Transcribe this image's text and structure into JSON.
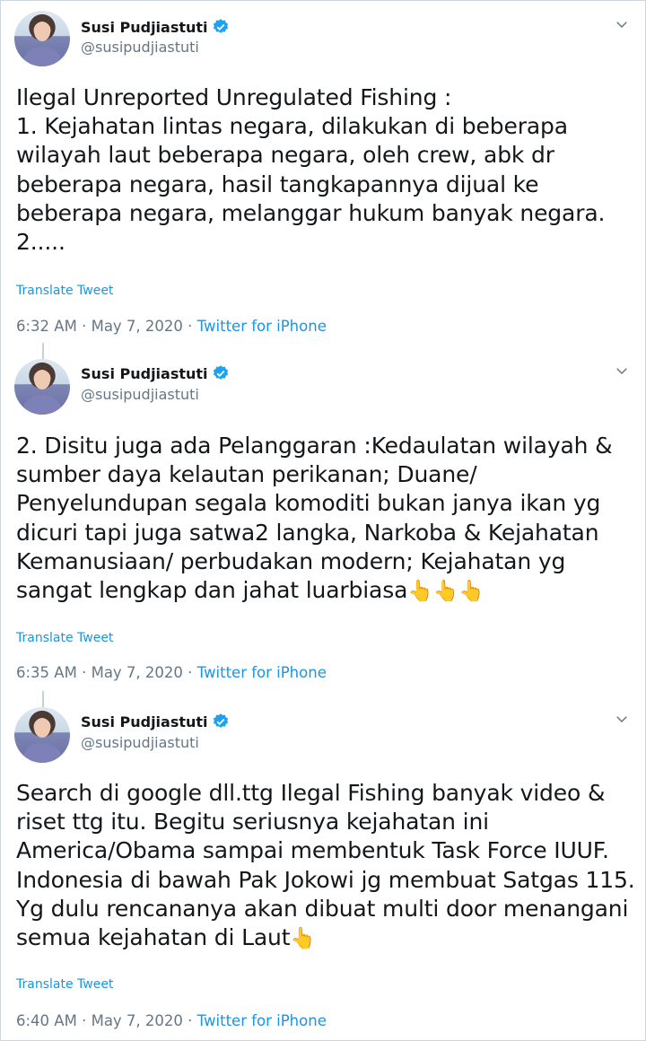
{
  "tweets": [
    {
      "author_name": "Susi Pudjiastuti",
      "handle": "@susipudjiastuti",
      "body": "Ilegal Unreported Unregulated Fishing :\n1. Kejahatan lintas negara, dilakukan di beberapa wilayah laut beberapa negara, oleh crew, abk dr beberapa negara, hasil tangkapannya dijual ke beberapa negara, melanggar hukum banyak negara.\n2.....",
      "emoji": "",
      "translate_label": "Translate Tweet",
      "time": "6:32 AM",
      "date": "May 7, 2020",
      "app": "Twitter for iPhone"
    },
    {
      "author_name": "Susi Pudjiastuti",
      "handle": "@susipudjiastuti",
      "body": "2. Disitu juga ada Pelanggaran :Kedaulatan wilayah & sumber daya kelautan perikanan; Duane/ Penyelundupan segala komoditi bukan janya ikan yg dicuri tapi juga satwa2 langka, Narkoba & Kejahatan Kemanusiaan/ perbudakan modern; Kejahatan yg sangat lengkap dan jahat luarbiasa",
      "emoji": "👆👆👆",
      "translate_label": "Translate Tweet",
      "time": "6:35 AM",
      "date": "May 7, 2020",
      "app": "Twitter for iPhone"
    },
    {
      "author_name": "Susi Pudjiastuti",
      "handle": "@susipudjiastuti",
      "body": "Search di google dll.ttg Ilegal Fishing banyak video & riset ttg itu. Begitu seriusnya kejahatan ini America/Obama sampai membentuk Task Force IUUF. Indonesia di bawah Pak Jokowi jg membuat Satgas 115. Yg dulu rencananya akan dibuat multi door menangani semua kejahatan di Laut",
      "emoji": "👆",
      "translate_label": "Translate Tweet",
      "time": "6:40 AM",
      "date": "May 7, 2020",
      "app": "Twitter for iPhone"
    }
  ],
  "meta_separator": " · ",
  "colors": {
    "link": "#1b95e0",
    "muted": "#657786",
    "verified": "#1da1f2"
  },
  "icons": {
    "verified": "verified-badge-icon",
    "more": "chevron-down-icon"
  }
}
